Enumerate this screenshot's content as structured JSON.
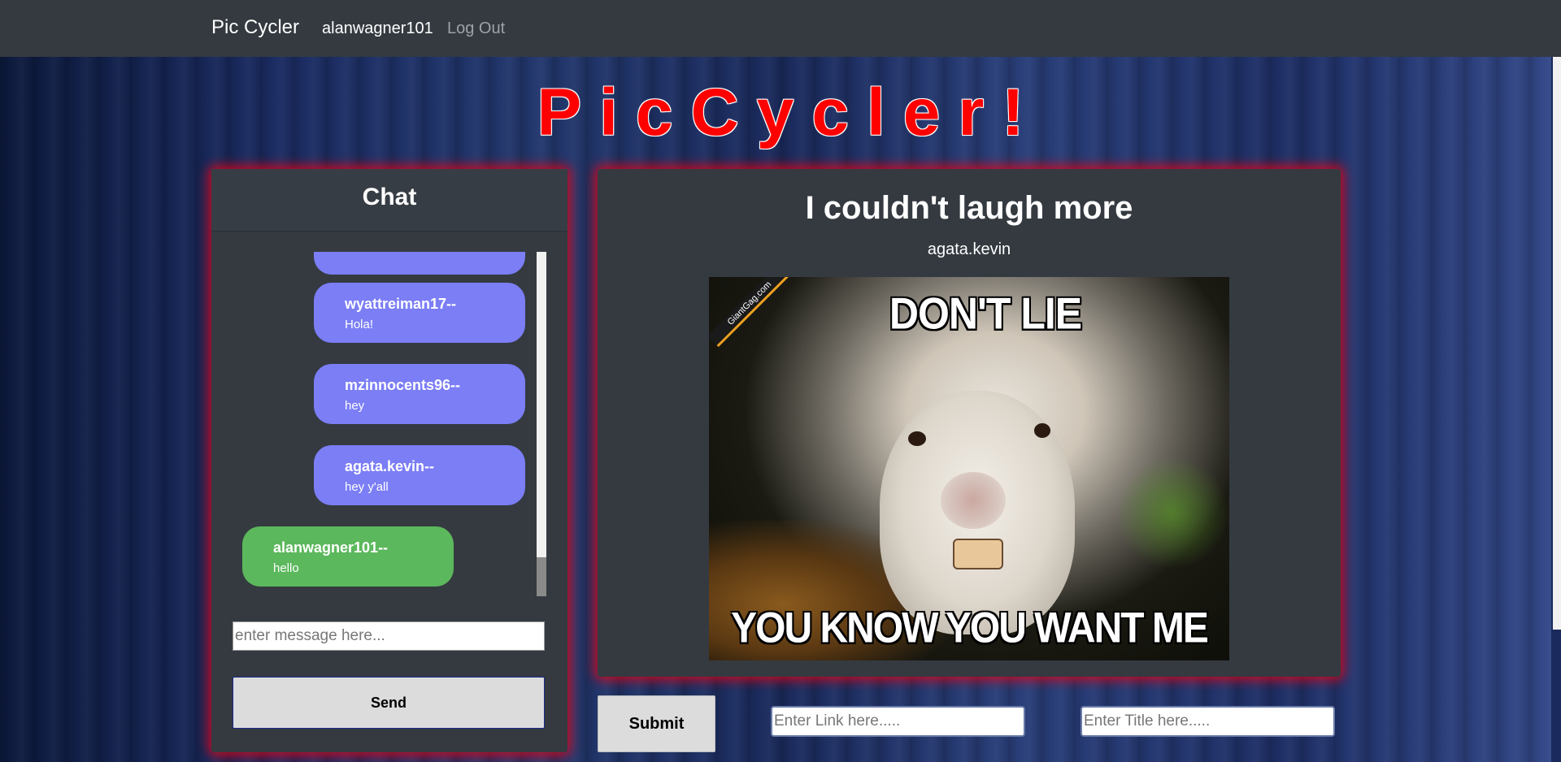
{
  "navbar": {
    "brand": "Pic Cycler",
    "username": "alanwagner101",
    "logout_label": "Log Out"
  },
  "logo_text": "PicCycler!",
  "chat": {
    "title": "Chat",
    "messages": [
      {
        "user": "",
        "text": "",
        "mine": false
      },
      {
        "user": "wyattreiman17--",
        "text": "Hola!",
        "mine": false
      },
      {
        "user": "mzinnocents96--",
        "text": "hey",
        "mine": false
      },
      {
        "user": "agata.kevin--",
        "text": "hey y'all",
        "mine": false
      },
      {
        "user": "alanwagner101--",
        "text": "hello",
        "mine": true
      }
    ],
    "input_placeholder": "enter message here...",
    "send_label": "Send"
  },
  "post": {
    "title": "I couldn't laugh more",
    "author": "agata.kevin",
    "meme_top_text": "DON'T LIE",
    "meme_bottom_text": "YOU KNOW YOU WANT ME",
    "meme_watermark": "GiantGag.com"
  },
  "submission": {
    "submit_label": "Submit",
    "link_placeholder": "Enter Link here.....",
    "title_placeholder": "Enter Title here....."
  },
  "colors": {
    "other_message_bubble": "#7b7ef5",
    "own_message_bubble": "#5cb85c",
    "panel_glow": "#e60014",
    "logo": "#ff0000"
  }
}
